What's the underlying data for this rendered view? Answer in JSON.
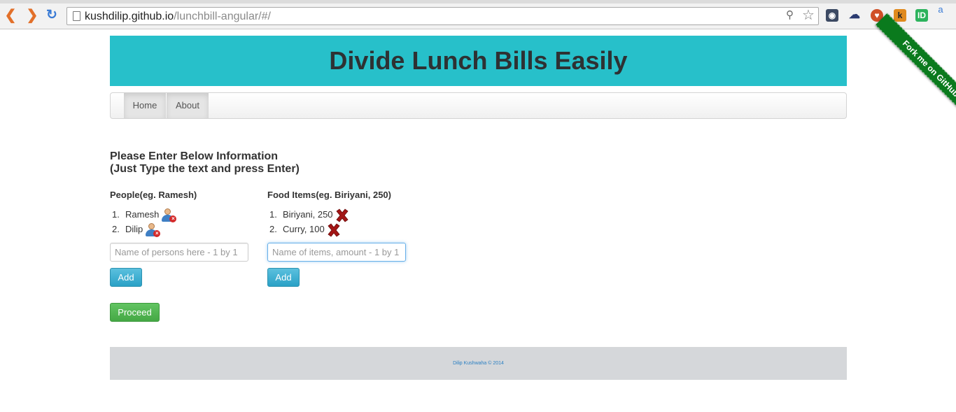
{
  "browser": {
    "url_host": "kushdilip.github.io",
    "url_path": "/lunchbill-angular/#/",
    "extension_a_label": "a",
    "extension_k_label": "k",
    "extension_id_label": "ID"
  },
  "ribbon": {
    "label": "Fork me on GitHub"
  },
  "header": {
    "title": "Divide Lunch Bills Easily",
    "background": "#27c0ca"
  },
  "nav": {
    "items": [
      {
        "label": "Home"
      },
      {
        "label": "About"
      }
    ]
  },
  "instructions": {
    "line1": "Please Enter Below Information",
    "line2": "(Just Type the text and press Enter)"
  },
  "people": {
    "heading": "People(eg. Ramesh)",
    "items": [
      {
        "num": "1.",
        "name": "Ramesh",
        "icon": "user-delete-icon"
      },
      {
        "num": "2.",
        "name": "Dilip",
        "icon": "user-delete-icon"
      }
    ],
    "input_placeholder": "Name of persons here - 1 by 1",
    "input_value": "",
    "add_label": "Add"
  },
  "food": {
    "heading": "Food Items(eg. Biriyani, 250)",
    "items": [
      {
        "num": "1.",
        "name": "Biriyani, 250",
        "icon": "delete-x-icon"
      },
      {
        "num": "2.",
        "name": "Curry, 100",
        "icon": "delete-x-icon"
      }
    ],
    "input_placeholder": "Name of items, amount - 1 by 1",
    "input_value": "",
    "add_label": "Add"
  },
  "proceed_label": "Proceed",
  "footer": {
    "text": "Dilip Kushwaha © 2014"
  },
  "colors": {
    "add_button": "#5bc0de",
    "proceed_button": "#5cb85c",
    "footer_bg": "#d5d7da",
    "delete_x": "#a31515"
  }
}
